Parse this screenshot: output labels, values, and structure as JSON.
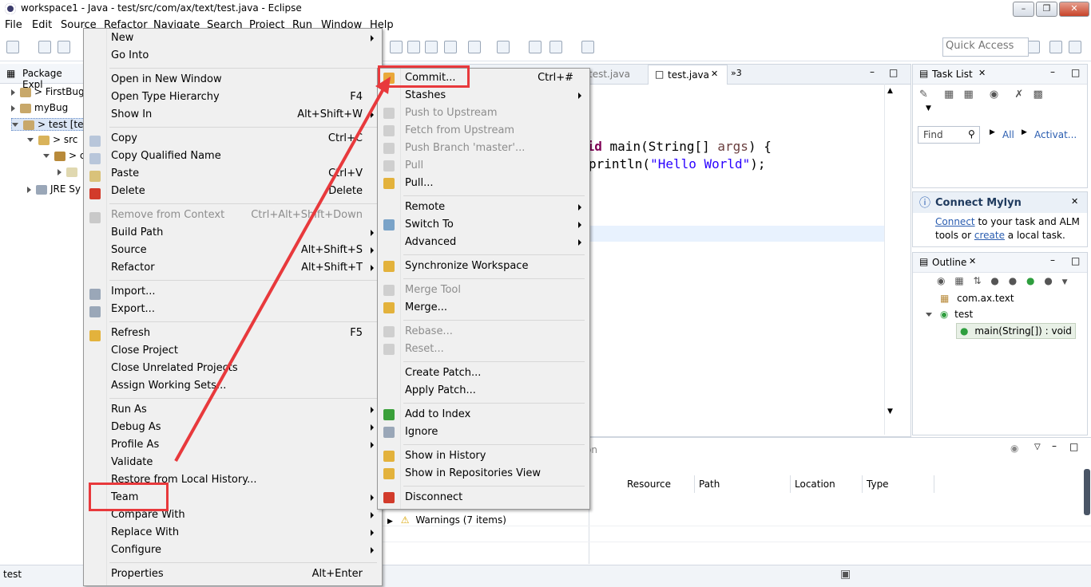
{
  "window": {
    "title": "workspace1 - Java - test/src/com/ax/text/test.java - Eclipse"
  },
  "menubar": [
    "File",
    "Edit",
    "Source",
    "Refactor",
    "Navigate",
    "Search",
    "Project",
    "Run",
    "Window",
    "Help"
  ],
  "toolbar": {
    "quick_access_placeholder": "Quick Access"
  },
  "package_explorer": {
    "title": "Package Expl",
    "items": [
      "> FirstBug",
      "myBug",
      "> test [te",
      "> src",
      "> c",
      "JRE Sy"
    ]
  },
  "editor": {
    "tabs": [
      "test.java",
      "test.java",
      "»3"
    ],
    "code_lines": [
      "oid main(String[] args) {",
      "println(\"Hello World\");"
    ]
  },
  "task_list": {
    "title": "Task List",
    "find_placeholder": "Find",
    "all_label": "All",
    "activate_label": "Activat..."
  },
  "mylyn": {
    "title": "Connect Mylyn",
    "connect_link": "Connect",
    "text1": " to your task and ALM",
    "text2": "tools or ",
    "create_link": "create",
    "text3": " a local task."
  },
  "outline": {
    "title": "Outline",
    "package": "com.ax.text",
    "class": "test",
    "method": "main(String[]) : void"
  },
  "problems": {
    "tab_hint": "on",
    "columns": [
      "Resource",
      "Path",
      "Location",
      "Type"
    ],
    "warnings_row": "Warnings (7 items)"
  },
  "statusbar": {
    "text": "test"
  },
  "context_menu": {
    "items": [
      {
        "label": "New",
        "sub": true
      },
      {
        "label": "Go Into"
      },
      {
        "sep": true
      },
      {
        "label": "Open in New Window"
      },
      {
        "label": "Open Type Hierarchy",
        "shortcut": "F4"
      },
      {
        "label": "Show In",
        "shortcut": "Alt+Shift+W",
        "sub": true
      },
      {
        "sep": true
      },
      {
        "label": "Copy",
        "shortcut": "Ctrl+C"
      },
      {
        "label": "Copy Qualified Name"
      },
      {
        "label": "Paste",
        "shortcut": "Ctrl+V"
      },
      {
        "label": "Delete",
        "shortcut": "Delete"
      },
      {
        "sep": true
      },
      {
        "label": "Remove from Context",
        "shortcut": "Ctrl+Alt+Shift+Down",
        "disabled": true
      },
      {
        "label": "Build Path",
        "sub": true
      },
      {
        "label": "Source",
        "shortcut": "Alt+Shift+S",
        "sub": true
      },
      {
        "label": "Refactor",
        "shortcut": "Alt+Shift+T",
        "sub": true
      },
      {
        "sep": true
      },
      {
        "label": "Import..."
      },
      {
        "label": "Export..."
      },
      {
        "sep": true
      },
      {
        "label": "Refresh",
        "shortcut": "F5"
      },
      {
        "label": "Close Project"
      },
      {
        "label": "Close Unrelated Projects"
      },
      {
        "label": "Assign Working Sets..."
      },
      {
        "sep": true
      },
      {
        "label": "Run As",
        "sub": true
      },
      {
        "label": "Debug As",
        "sub": true
      },
      {
        "label": "Profile As",
        "sub": true
      },
      {
        "label": "Validate"
      },
      {
        "label": "Restore from Local History..."
      },
      {
        "label": "Team",
        "sub": true,
        "highlighted": true
      },
      {
        "label": "Compare With",
        "sub": true
      },
      {
        "label": "Replace With",
        "sub": true
      },
      {
        "label": "Configure",
        "sub": true
      },
      {
        "sep": true
      },
      {
        "label": "Properties",
        "shortcut": "Alt+Enter"
      }
    ]
  },
  "team_menu": {
    "items": [
      {
        "label": "Commit...",
        "shortcut": "Ctrl+#",
        "highlighted": true
      },
      {
        "label": "Stashes",
        "sub": true
      },
      {
        "label": "Push to Upstream",
        "disabled": true
      },
      {
        "label": "Fetch from Upstream",
        "disabled": true
      },
      {
        "label": "Push Branch 'master'...",
        "disabled": true
      },
      {
        "label": "Pull",
        "disabled": true
      },
      {
        "label": "Pull..."
      },
      {
        "sep": true
      },
      {
        "label": "Remote",
        "sub": true
      },
      {
        "label": "Switch To",
        "sub": true
      },
      {
        "label": "Advanced",
        "sub": true
      },
      {
        "sep": true
      },
      {
        "label": "Synchronize Workspace"
      },
      {
        "sep": true
      },
      {
        "label": "Merge Tool",
        "disabled": true
      },
      {
        "label": "Merge..."
      },
      {
        "sep": true
      },
      {
        "label": "Rebase...",
        "disabled": true
      },
      {
        "label": "Reset...",
        "disabled": true
      },
      {
        "sep": true
      },
      {
        "label": "Create Patch..."
      },
      {
        "label": "Apply Patch..."
      },
      {
        "sep": true
      },
      {
        "label": "Add to Index"
      },
      {
        "label": "Ignore"
      },
      {
        "sep": true
      },
      {
        "label": "Show in History"
      },
      {
        "label": "Show in Repositories View"
      },
      {
        "sep": true
      },
      {
        "label": "Disconnect"
      }
    ]
  },
  "colors": {
    "highlight_box": "#e8393c",
    "arrow": "#e8393c",
    "string_literal": "#2a00ff",
    "keyword": "#7f0055"
  },
  "icons": {
    "ctx_icons": [
      "copy-icon",
      "copy-qualified-icon",
      "paste-icon",
      "delete-icon",
      "remove-context-icon",
      "import-icon",
      "export-icon",
      "refresh-icon"
    ],
    "team_icons": [
      "commit-icon",
      "push-icon",
      "fetch-icon",
      "push-branch-icon",
      "pull-icon",
      "pull-dialog-icon",
      "switch-icon",
      "sync-icon",
      "merge-tool-icon",
      "merge-icon",
      "rebase-icon",
      "reset-icon",
      "add-index-icon",
      "ignore-icon",
      "history-icon",
      "repositories-icon",
      "disconnect-icon"
    ]
  }
}
